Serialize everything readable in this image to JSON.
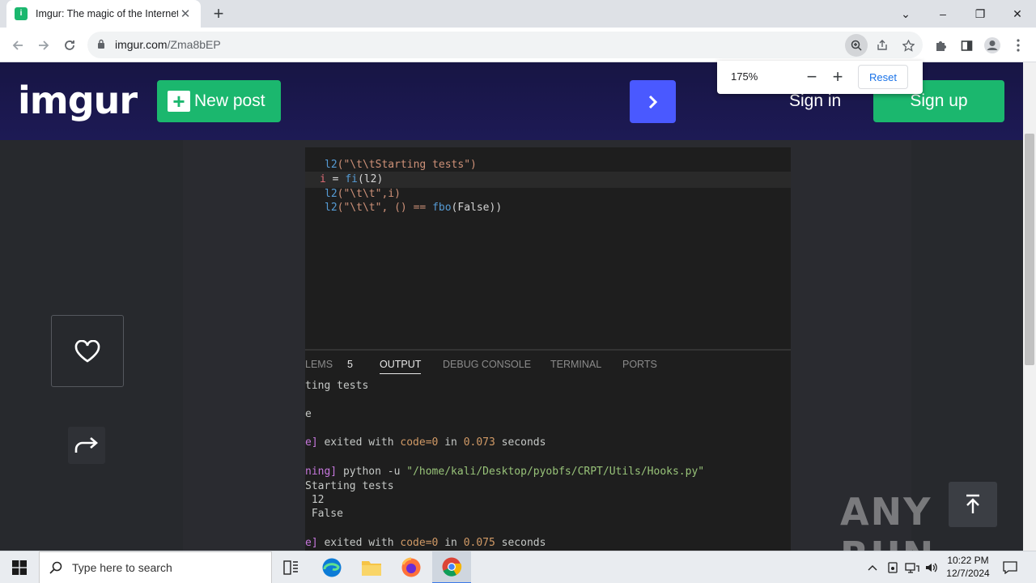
{
  "browser": {
    "tab_title": "Imgur: The magic of the Internet",
    "tab_close": "✕",
    "new_tab": "+",
    "url_host": "imgur.com",
    "url_path": "/Zma8bEP",
    "window_controls": {
      "minimize": "–",
      "restore": "❐",
      "close": "✕",
      "dropdown": "⌄"
    }
  },
  "zoom_popup": {
    "value": "175%",
    "minus": "−",
    "plus": "+",
    "reset_label": "Reset"
  },
  "imgur": {
    "logo": "imgur",
    "new_post_label": "New post",
    "next_arrow": "›",
    "sign_in": "Sign in",
    "sign_up": "Sign up"
  },
  "code": {
    "line1": {
      "fn": "l2",
      "rest": "(\"\\t\\tStarting tests\")"
    },
    "line2": {
      "var": "i",
      "eq": " = ",
      "fn": "fi",
      "rest": "(l2)"
    },
    "line3": {
      "fn": "l2",
      "rest": "(\"\\t\\t\",i)"
    },
    "line4": {
      "fn": "l2",
      "rest": "(\"\\t\\t\", () == ",
      "fn2": "fbo",
      "rest2": "(False))"
    }
  },
  "panel": {
    "tabs": [
      "LEMS",
      "5",
      "OUTPUT",
      "DEBUG CONSOLE",
      "TERMINAL",
      "PORTS"
    ],
    "active_tab": "OUTPUT",
    "output": {
      "l1": "ting tests",
      "l2": "e",
      "l3a": "e] ",
      "l3b": "exited with ",
      "l3c": "code=0",
      "l3d": " in ",
      "l3e": "0.073",
      "l3f": " seconds",
      "l4a": "ning] ",
      "l4b": "python -u ",
      "l4c": "\"/home/kali/Desktop/pyobfs/CRPT/Utils/Hooks.py\"",
      "l5": "Starting tests",
      "l6": " 12",
      "l7": " False",
      "l8a": "e] ",
      "l8b": "exited with ",
      "l8c": "code=0",
      "l8d": " in ",
      "l8e": "0.075",
      "l8f": " seconds"
    }
  },
  "watermark": "ANY RUN",
  "taskbar": {
    "search_placeholder": "Type here to search",
    "time": "10:22 PM",
    "date": "12/7/2024"
  }
}
